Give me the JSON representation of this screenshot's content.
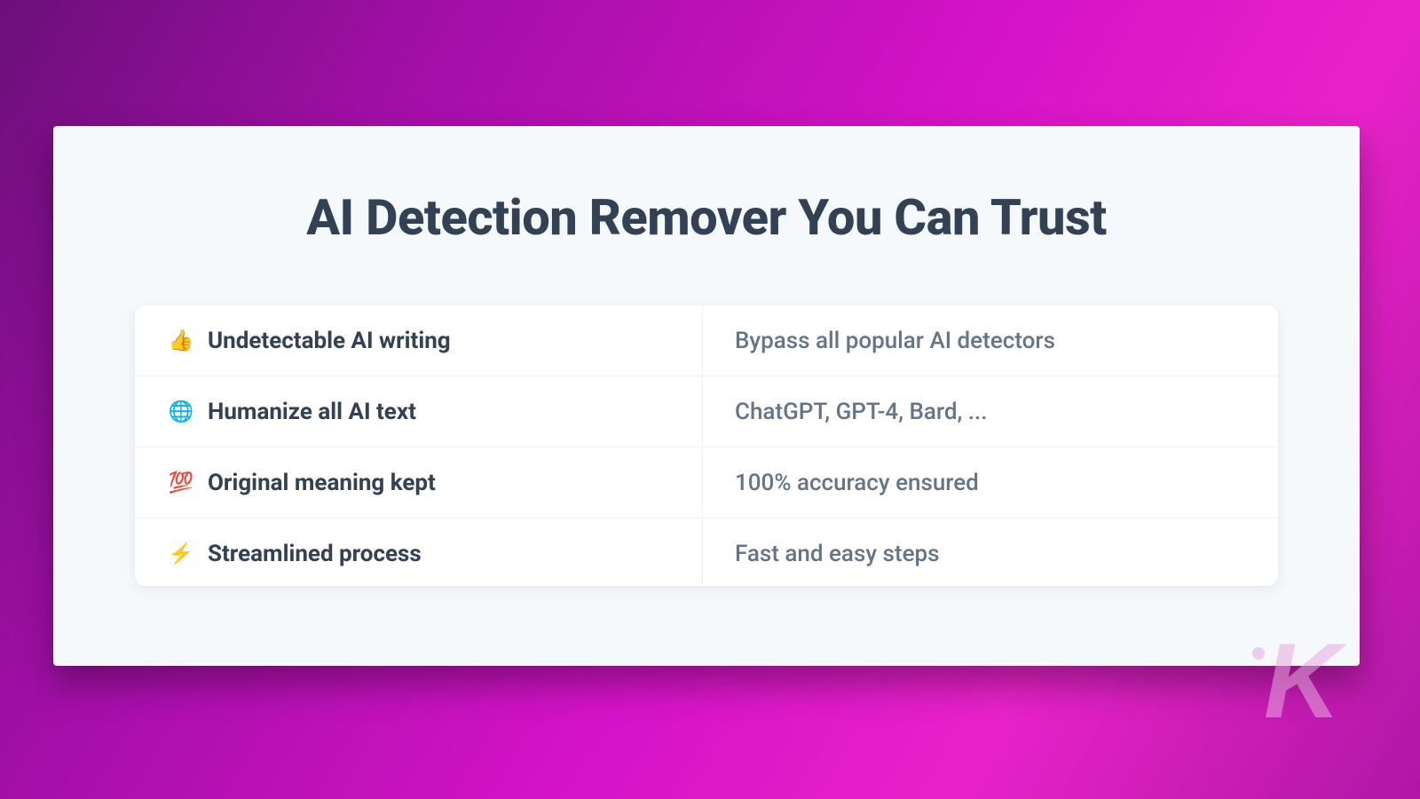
{
  "heading": "AI Detection Remover You Can Trust",
  "rows": [
    {
      "icon": "👍",
      "icon_name": "thumbs-up-icon",
      "feature": "Undetectable AI writing",
      "desc": "Bypass all popular AI detectors"
    },
    {
      "icon": "🌐",
      "icon_name": "globe-icon",
      "feature": "Humanize all AI text",
      "desc": "ChatGPT, GPT-4, Bard, ..."
    },
    {
      "icon": "💯",
      "icon_name": "hundred-icon",
      "feature": "Original meaning kept",
      "desc": "100% accuracy ensured"
    },
    {
      "icon": "⚡",
      "icon_name": "bolt-icon",
      "feature": "Streamlined process",
      "desc": "Fast and easy steps"
    }
  ],
  "watermark_letter": "K",
  "colors": {
    "bg_gradient_start": "#6b0f7a",
    "bg_gradient_end": "#b017a6",
    "card_bg": "#f6f9fc",
    "heading": "#334155",
    "feature_text": "#334155",
    "desc_text": "#64748b",
    "border": "#eef2f6"
  }
}
